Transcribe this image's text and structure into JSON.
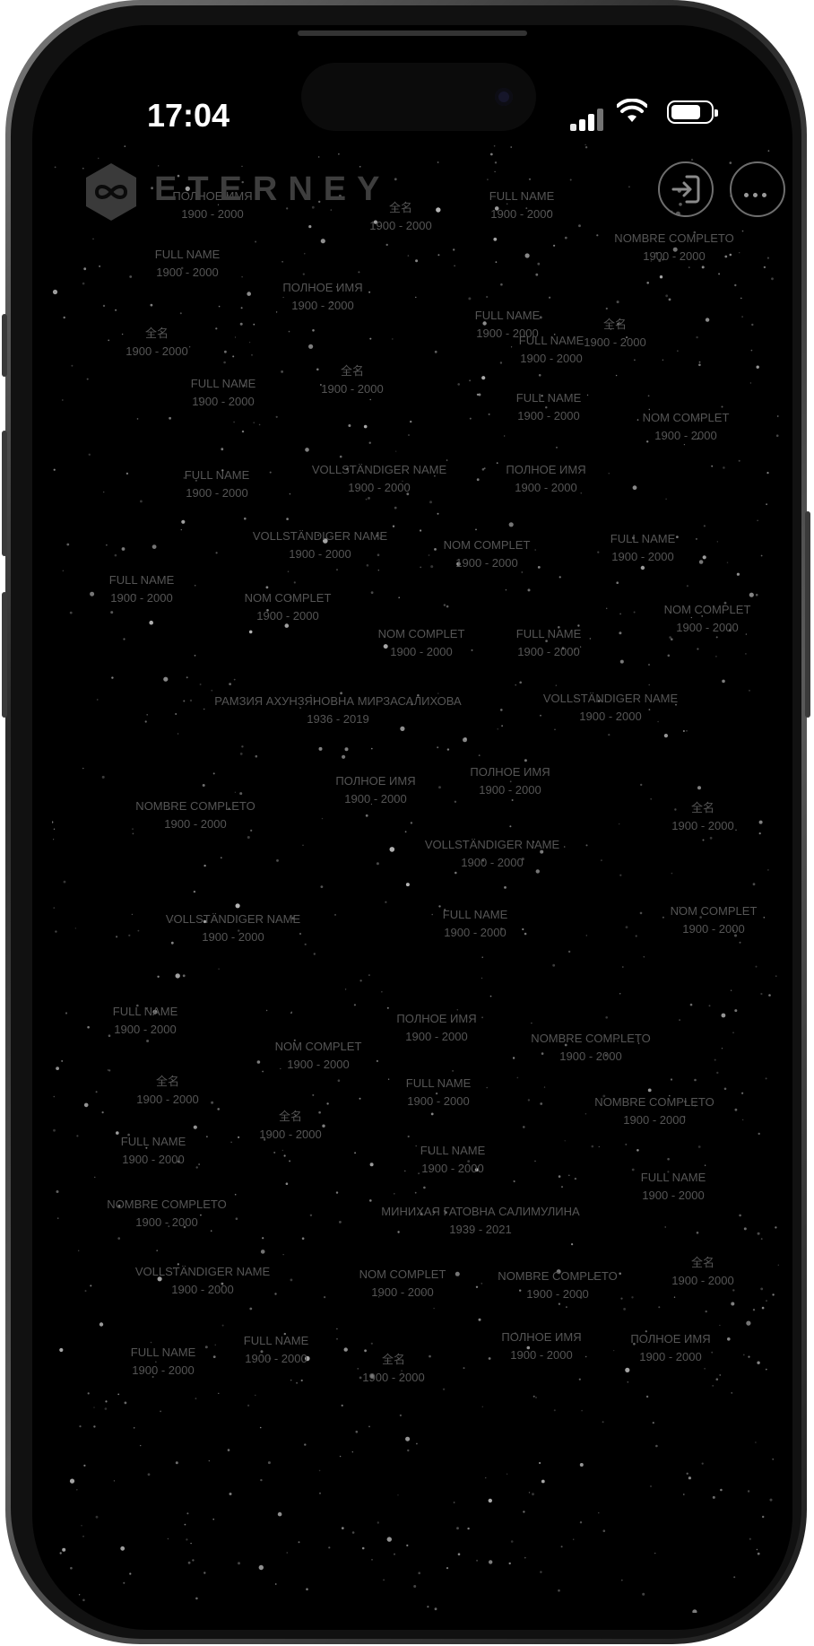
{
  "status_bar": {
    "time": "17:04"
  },
  "header": {
    "logo_text": "ETERNEY",
    "logo_icon": "infinity-icon",
    "login_icon": "login-icon",
    "more_icon": "more-dots-icon"
  },
  "colors": {
    "background": "#000000",
    "label": "#555555",
    "star": "#bfbfbf"
  },
  "memorials": [
    {
      "name": "ПОЛНОЕ ИМЯ",
      "dates": "1900 - 2000"
    },
    {
      "name": "全名",
      "dates": "1900 - 2000"
    },
    {
      "name": "FULL NAME",
      "dates": "1900 - 2000"
    },
    {
      "name": "FULL NAME",
      "dates": "1900 - 2000"
    },
    {
      "name": "NOMBRE COMPLETO",
      "dates": "1900 - 2000"
    },
    {
      "name": "FULL NAME",
      "dates": "1900 - 2000"
    },
    {
      "name": "ПОЛНОЕ ИМЯ",
      "dates": "1900 - 2000"
    },
    {
      "name": "全名",
      "dates": "1900 - 2000"
    },
    {
      "name": "FULL NAME",
      "dates": "1900 - 2000"
    },
    {
      "name": "全名",
      "dates": "1900 - 2000"
    },
    {
      "name": "FULL NAME",
      "dates": "1900 - 2000"
    },
    {
      "name": "全名",
      "dates": "1900 - 2000"
    },
    {
      "name": "FULL NAME",
      "dates": "1900 - 2000"
    },
    {
      "name": "NOM COMPLET",
      "dates": "1900 - 2000"
    },
    {
      "name": "FULL NAME",
      "dates": "1900 - 2000"
    },
    {
      "name": "VOLLSTÄNDIGER NAME",
      "dates": "1900 - 2000"
    },
    {
      "name": "ПОЛНОЕ ИМЯ",
      "dates": "1900 - 2000"
    },
    {
      "name": "VOLLSTÄNDIGER NAME",
      "dates": "1900 - 2000"
    },
    {
      "name": "NOM COMPLET",
      "dates": "1900 - 2000"
    },
    {
      "name": "FULL NAME",
      "dates": "1900 - 2000"
    },
    {
      "name": "FULL NAME",
      "dates": "1900 - 2000"
    },
    {
      "name": "NOM COMPLET",
      "dates": "1900 - 2000"
    },
    {
      "name": "NOM COMPLET",
      "dates": "1900 - 2000"
    },
    {
      "name": "NOM COMPLET",
      "dates": "1900 - 2000"
    },
    {
      "name": "FULL NAME",
      "dates": "1900 - 2000"
    },
    {
      "name": "РАМЗИЯ АХУНЗЯНОВНА МИРЗАСАЛИХОВА",
      "dates": "1936 - 2019"
    },
    {
      "name": "VOLLSTÄNDIGER NAME",
      "dates": "1900 - 2000"
    },
    {
      "name": "ПОЛНОЕ ИМЯ",
      "dates": "1900 - 2000"
    },
    {
      "name": "ПОЛНОЕ ИМЯ",
      "dates": "1900 - 2000"
    },
    {
      "name": "NOMBRE COMPLETO",
      "dates": "1900 - 2000"
    },
    {
      "name": "全名",
      "dates": "1900 - 2000"
    },
    {
      "name": "VOLLSTÄNDIGER NAME",
      "dates": "1900 - 2000"
    },
    {
      "name": "VOLLSTÄNDIGER NAME",
      "dates": "1900 - 2000"
    },
    {
      "name": "FULL NAME",
      "dates": "1900 - 2000"
    },
    {
      "name": "NOM COMPLET",
      "dates": "1900 - 2000"
    },
    {
      "name": "FULL NAME",
      "dates": "1900 - 2000"
    },
    {
      "name": "ПОЛНОЕ ИМЯ",
      "dates": "1900 - 2000"
    },
    {
      "name": "NOM COMPLET",
      "dates": "1900 - 2000"
    },
    {
      "name": "NOMBRE COMPLETO",
      "dates": "1900 - 2000"
    },
    {
      "name": "全名",
      "dates": "1900 - 2000"
    },
    {
      "name": "FULL NAME",
      "dates": "1900 - 2000"
    },
    {
      "name": "全名",
      "dates": "1900 - 2000"
    },
    {
      "name": "NOMBRE COMPLETO",
      "dates": "1900 - 2000"
    },
    {
      "name": "FULL NAME",
      "dates": "1900 - 2000"
    },
    {
      "name": "FULL NAME",
      "dates": "1900 - 2000"
    },
    {
      "name": "FULL NAME",
      "dates": "1900 - 2000"
    },
    {
      "name": "NOMBRE COMPLETO",
      "dates": "1900 - 2000"
    },
    {
      "name": "МИНИХАЯ ГАТОВНА САЛИМУЛИНА",
      "dates": "1939 - 2021"
    },
    {
      "name": "VOLLSTÄNDIGER NAME",
      "dates": "1900 - 2000"
    },
    {
      "name": "NOM COMPLET",
      "dates": "1900 - 2000"
    },
    {
      "name": "NOMBRE COMPLETO",
      "dates": "1900 - 2000"
    },
    {
      "name": "全名",
      "dates": "1900 - 2000"
    },
    {
      "name": "FULL NAME",
      "dates": "1900 - 2000"
    },
    {
      "name": "FULL NAME",
      "dates": "1900 - 2000"
    },
    {
      "name": "ПОЛНОЕ ИМЯ",
      "dates": "1900 - 2000"
    },
    {
      "name": "ПОЛНОЕ ИМЯ",
      "dates": "1900 - 2000"
    },
    {
      "name": "全名",
      "dates": "1900 - 2000"
    }
  ]
}
